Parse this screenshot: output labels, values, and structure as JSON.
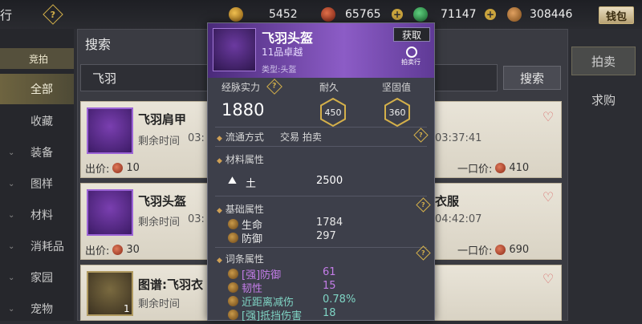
{
  "topbar": {
    "title_fragment": "行",
    "currencies": [
      {
        "icon": "gold-ingot-icon",
        "value": "5452"
      },
      {
        "icon": "red-coin-icon",
        "value": "65765"
      },
      {
        "icon": "jade-icon",
        "value": "71147"
      },
      {
        "icon": "bronze-coin-icon",
        "value": "308446"
      }
    ],
    "money_button": "钱包"
  },
  "sidebar": {
    "header": "竞拍",
    "items": [
      {
        "label": "全部",
        "active": true
      },
      {
        "label": "收藏"
      },
      {
        "label": "装备"
      },
      {
        "label": "图样"
      },
      {
        "label": "材料"
      },
      {
        "label": "消耗品"
      },
      {
        "label": "家园"
      },
      {
        "label": "宠物"
      }
    ]
  },
  "search": {
    "panel_title": "搜索",
    "input_value": "飞羽",
    "button": "搜索"
  },
  "right_tabs": [
    "拍卖",
    "求购"
  ],
  "cards": [
    {
      "name": "飞羽肩甲",
      "time_label": "剩余时间",
      "time_prefix": "03:",
      "bid_label": "出价:",
      "bid_value": "10",
      "buyout_label": "一口价:",
      "buyout_value": "410",
      "time_value": "03:37:41"
    },
    {
      "name": "飞羽头盔",
      "time_label": "剩余时间",
      "time_prefix": "03:",
      "bid_label": "出价:",
      "bid_value": "30",
      "buyout_label": "一口价:",
      "buyout_value": "690",
      "time_value": "04:42:07",
      "right_name_fragment": "衣服"
    },
    {
      "name": "图谱:飞羽衣",
      "time_label": "剩余时间",
      "count": "1"
    }
  ],
  "popup": {
    "title": "飞羽头盔",
    "grade": "11品卓越",
    "type": "类型:头盔",
    "get_button": "获取",
    "auction_label": "拍卖行",
    "power_label": "经脉实力",
    "power_value": "1880",
    "durability_label": "耐久",
    "durability_value": "450",
    "firmness_label": "坚固值",
    "firmness_value": "360",
    "circulation_label": "流通方式",
    "circulation_value": "交易 拍卖",
    "material_section": "材料属性",
    "material_name": "土",
    "material_value": "2500",
    "basic_section": "基础属性",
    "basic": [
      {
        "name": "生命",
        "value": "1784"
      },
      {
        "name": "防御",
        "value": "297"
      }
    ],
    "entry_section": "词条属性",
    "entries": [
      {
        "name": "[强]防御",
        "value": "61",
        "color": "#c47de8"
      },
      {
        "name": "韧性",
        "value": "15",
        "color": "#c47de8"
      },
      {
        "name": "近距离减伤",
        "value": "0.78%",
        "color": "#7fd4c4"
      },
      {
        "name": "[强]抵挡伤害",
        "value": "18",
        "color": "#7fd4c4"
      }
    ]
  }
}
